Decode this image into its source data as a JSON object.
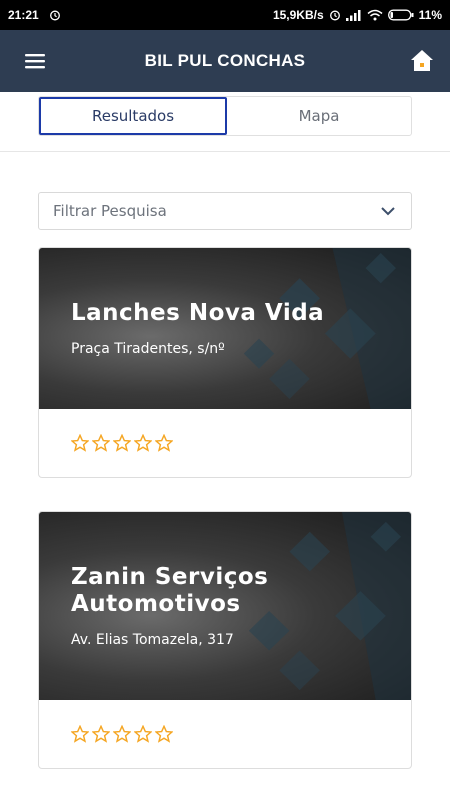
{
  "status_bar": {
    "time": "21:21",
    "net_speed": "15,9KB/s",
    "battery": "11%"
  },
  "app_bar": {
    "title": "BIL PUL CONCHAS",
    "menu_icon": "hamburger-menu-icon",
    "home_icon": "home-icon"
  },
  "tabs": [
    {
      "label": "Resultados",
      "active": true
    },
    {
      "label": "Mapa",
      "active": false
    }
  ],
  "filter": {
    "label": "Filtrar Pesquisa",
    "icon": "chevron-down-icon"
  },
  "results": [
    {
      "name": "Lanches Nova Vida",
      "address": "Praça Tiradentes, s/nº",
      "rating": 0,
      "max_rating": 5
    },
    {
      "name": "Zanin Serviços Automotivos",
      "address": "Av. Elias Tomazela, 317",
      "rating": 0,
      "max_rating": 5
    }
  ],
  "colors": {
    "app_bar": "#2e3d52",
    "active_tab_border": "#1c3aa8",
    "star": "#f5a623"
  }
}
